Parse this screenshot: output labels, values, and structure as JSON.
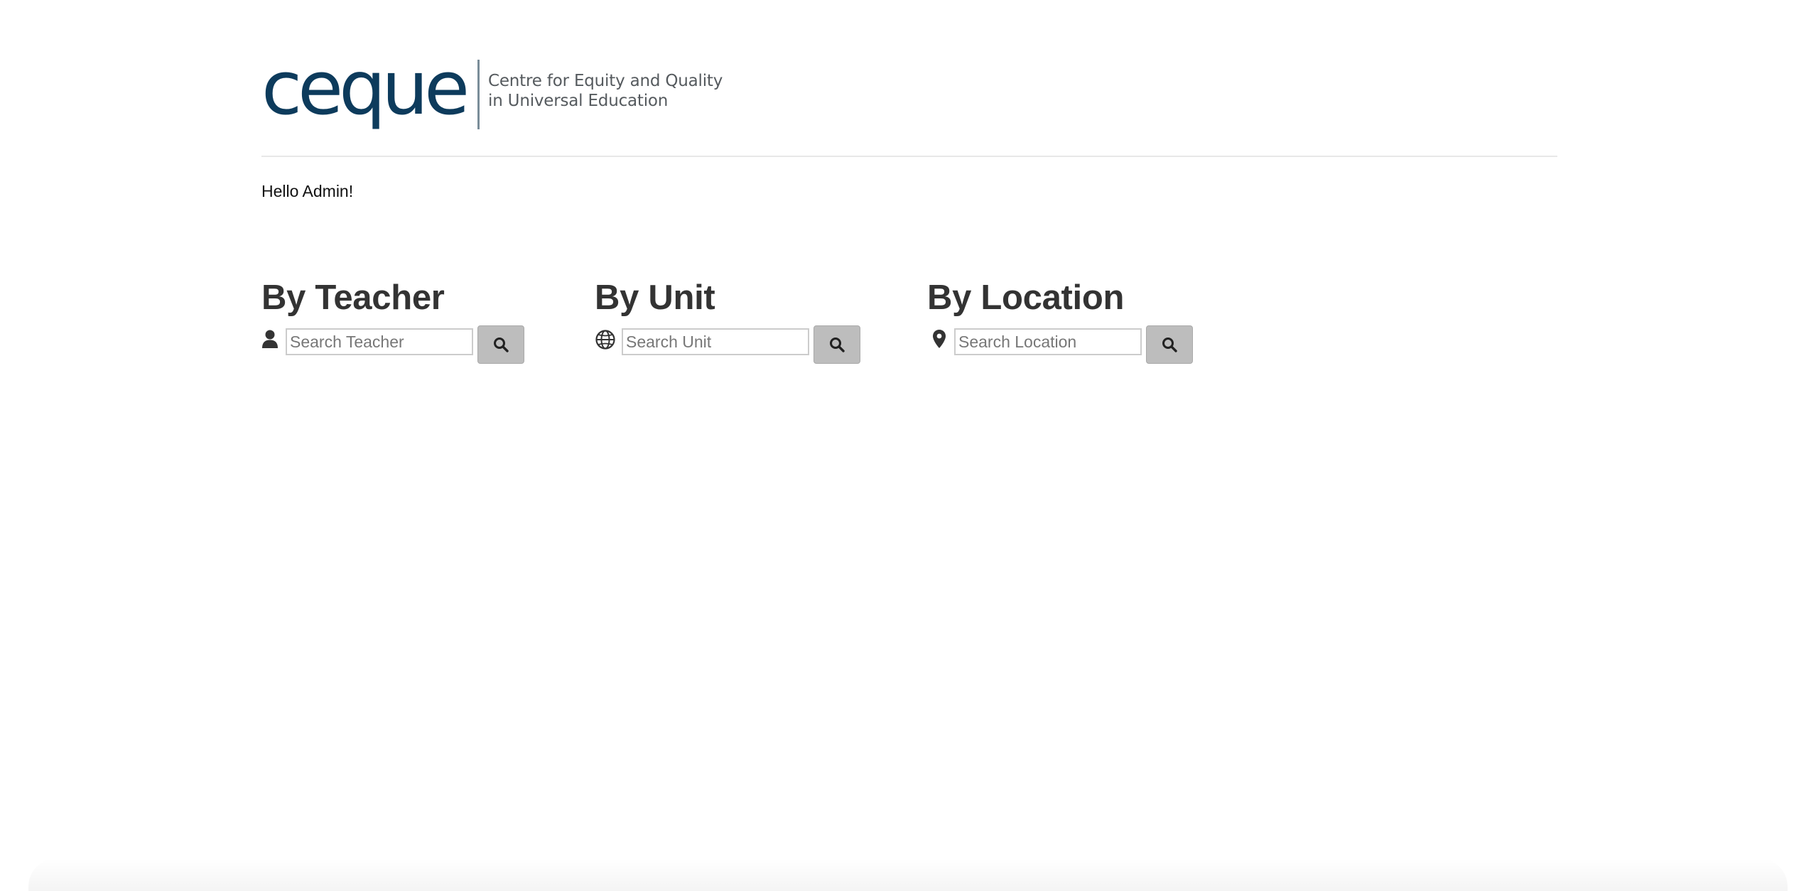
{
  "header": {
    "logo_word": "ceque",
    "tagline_line1": "Centre for Equity and Quality",
    "tagline_line2": "in Universal Education",
    "logo_color": "#0d3b5c"
  },
  "greeting": "Hello Admin!",
  "search_sections": [
    {
      "heading": "By Teacher",
      "icon": "user-icon",
      "placeholder": "Search Teacher",
      "value": "",
      "button_icon": "search-icon"
    },
    {
      "heading": "By Unit",
      "icon": "globe-icon",
      "placeholder": "Search Unit",
      "value": "",
      "button_icon": "search-icon"
    },
    {
      "heading": "By Location",
      "icon": "map-marker-icon",
      "placeholder": "Search Location",
      "value": "",
      "button_icon": "search-icon"
    }
  ],
  "colors": {
    "heading": "#333333",
    "button_bg": "#bdbdbd",
    "divider": "#e8e8e8"
  }
}
